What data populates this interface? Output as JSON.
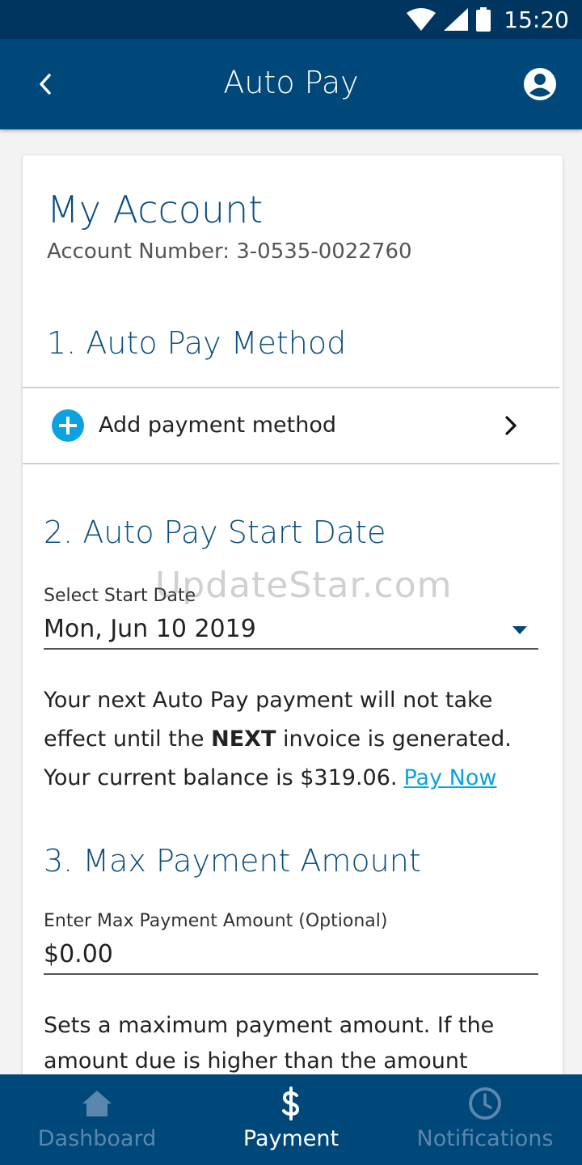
{
  "status_bar": {
    "time": "15:20"
  },
  "app_bar": {
    "title": "Auto Pay"
  },
  "account": {
    "title": "My Account",
    "number_line": "Account Number: 3-0535-0022760"
  },
  "sections": {
    "method": {
      "title": "1. Auto Pay Method",
      "add_label": "Add payment method"
    },
    "start_date": {
      "title": "2. Auto Pay Start Date",
      "field_label": "Select Start Date",
      "field_value": "Mon, Jun 10 2019",
      "info_part1": "Your next Auto Pay payment will not take effect until the ",
      "info_bold": "NEXT",
      "info_part2": " invoice is generated. Your current balance is $319.06.",
      "pay_now": "Pay Now"
    },
    "max_amount": {
      "title": "3. Max Payment Amount",
      "field_label": "Enter Max Payment Amount (Optional)",
      "field_value": "$0.00",
      "info": "Sets a maximum payment amount. If the amount due is higher than the amount"
    }
  },
  "watermark": "UpdateStar.com",
  "bottom_nav": {
    "items": [
      {
        "label": "Dashboard",
        "icon": "home-icon",
        "active": false
      },
      {
        "label": "Payment",
        "icon": "dollar-icon",
        "active": true
      },
      {
        "label": "Notifications",
        "icon": "clock-icon",
        "active": false
      }
    ]
  },
  "colors": {
    "primary": "#004879",
    "status_bar": "#00355f",
    "accent": "#0aa3e0",
    "heading": "#0b4f7f",
    "nav_inactive": "#5a87ad"
  }
}
